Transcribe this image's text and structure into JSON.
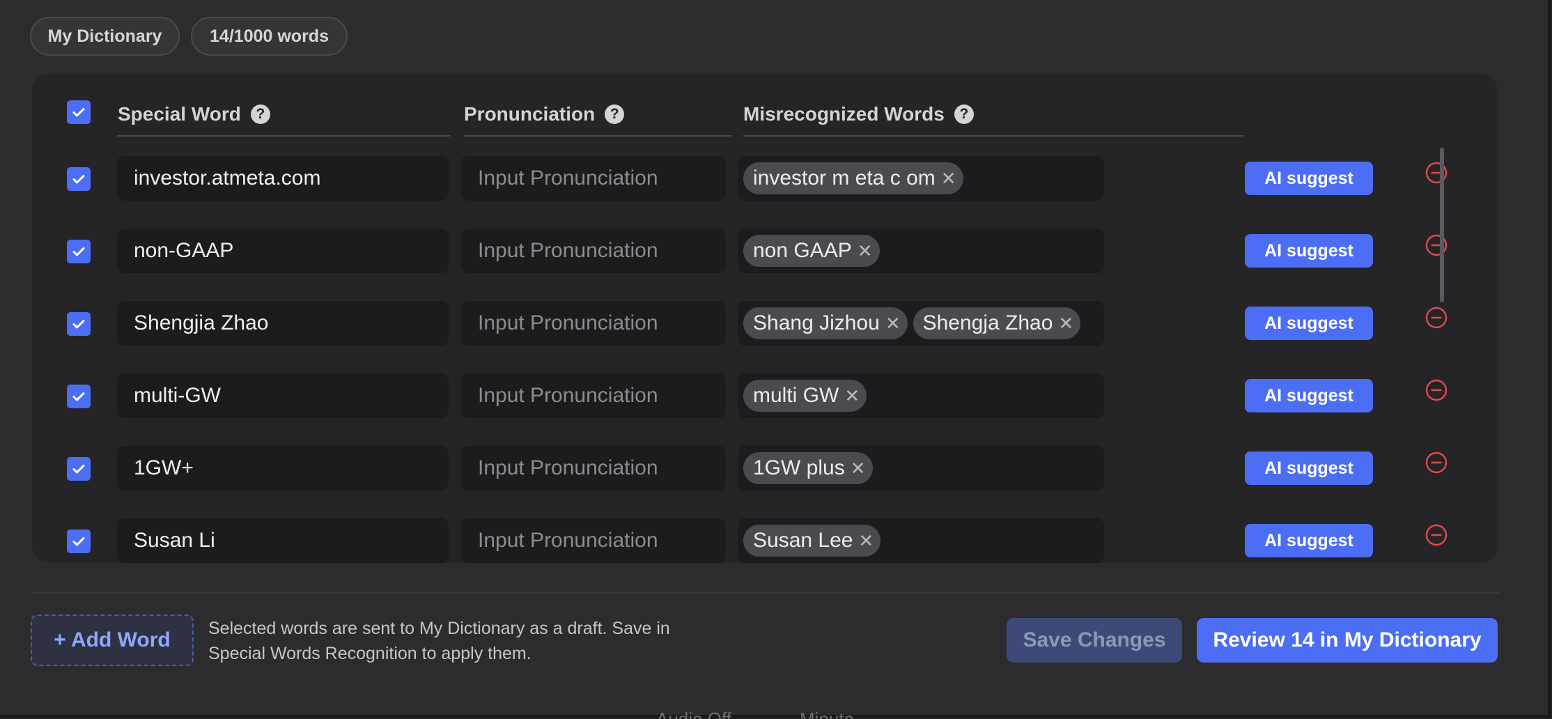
{
  "header": {
    "dictionary_label": "My Dictionary",
    "word_count": "14/1000 words"
  },
  "table": {
    "columns": {
      "special_word": "Special Word",
      "pronunciation": "Pronunciation",
      "misrecognized": "Misrecognized Words"
    },
    "pronunciation_placeholder": "Input Pronunciation",
    "ai_suggest_label": "AI suggest",
    "rows": [
      {
        "word": "investor.atmeta.com",
        "misrecognized": [
          "investor m eta c om"
        ]
      },
      {
        "word": "non-GAAP",
        "misrecognized": [
          "non GAAP"
        ]
      },
      {
        "word": "Shengjia Zhao",
        "misrecognized": [
          "Shang Jizhou",
          "Shengja Zhao"
        ]
      },
      {
        "word": "multi-GW",
        "misrecognized": [
          "multi GW"
        ]
      },
      {
        "word": "1GW+",
        "misrecognized": [
          "1GW plus"
        ]
      },
      {
        "word": "Susan Li",
        "misrecognized": [
          "Susan Lee"
        ]
      }
    ]
  },
  "footer": {
    "add_word_label": "+ Add Word",
    "note": "Selected words are sent to My Dictionary as a draft. Save in Special Words Recognition to apply them.",
    "save_label": "Save Changes",
    "review_label": "Review 14 in My Dictionary"
  },
  "background_text": [
    "Audio Off",
    "Minute"
  ],
  "colors": {
    "accent": "#4c6ef5",
    "remove": "#e5484d",
    "panel": "#2c2c2e"
  },
  "icons": [
    "checkbox-checked-icon",
    "help-icon",
    "remove-circle-icon",
    "close-x-icon"
  ]
}
